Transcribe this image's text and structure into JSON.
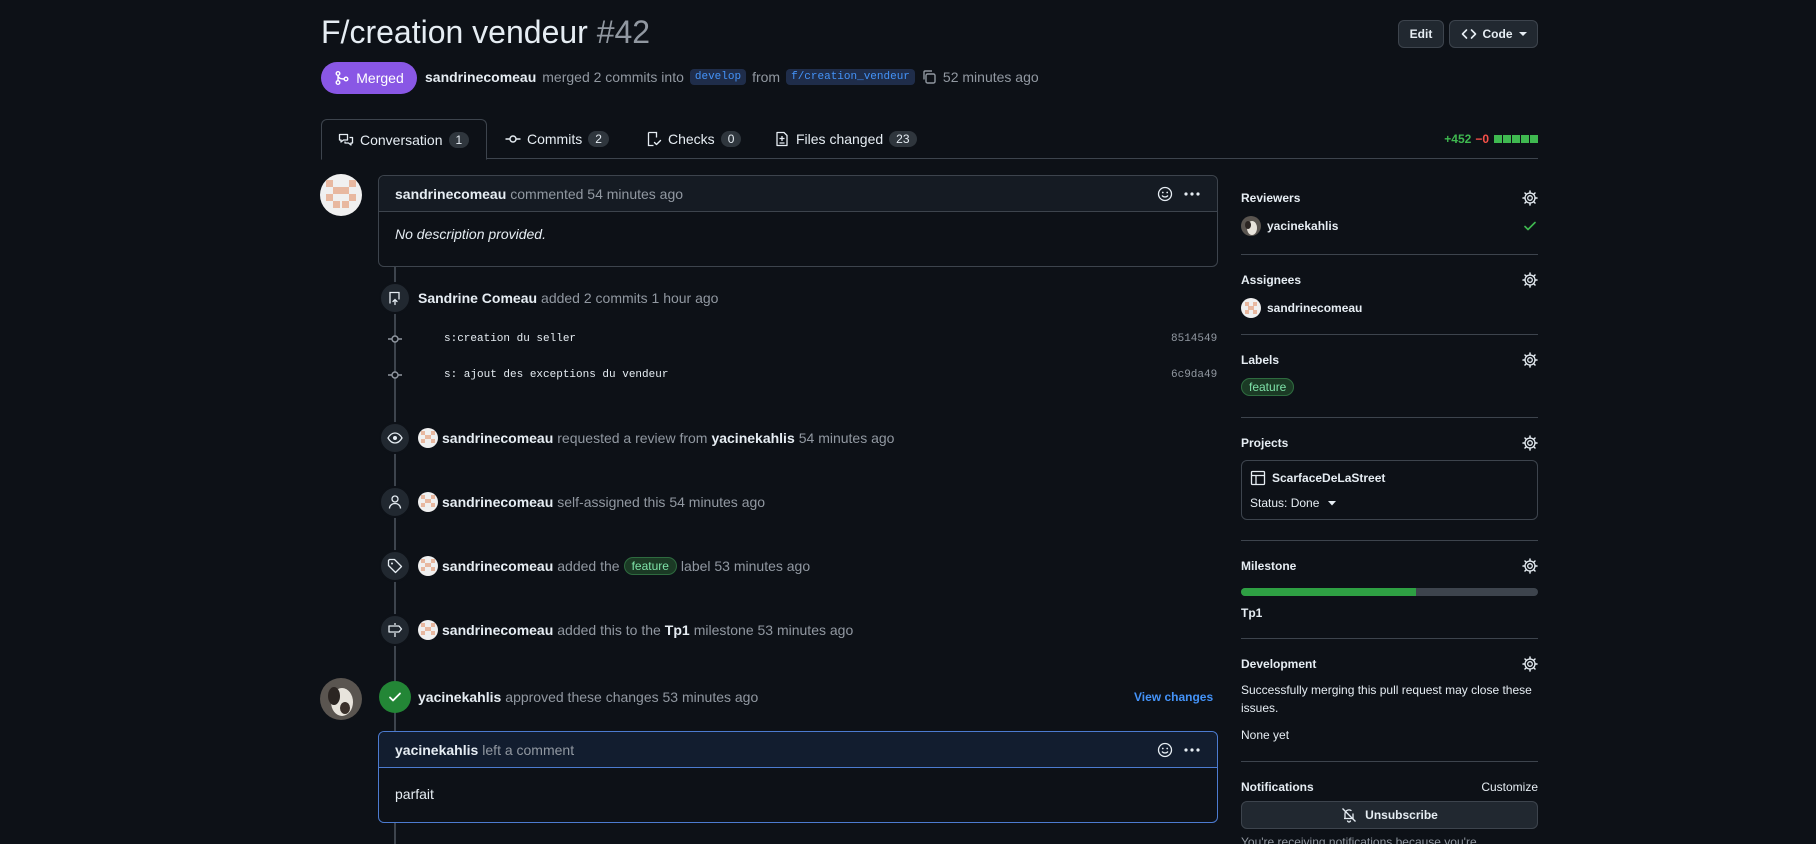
{
  "header": {
    "title": "F/creation vendeur",
    "number": "#42",
    "edit_label": "Edit",
    "code_label": "Code",
    "status": "Merged",
    "author": "sandrinecomeau",
    "merged_text": "merged 2 commits into",
    "base_branch": "develop",
    "from_text": "from",
    "head_branch": "f/creation_vendeur",
    "time": "52 minutes ago"
  },
  "tabs": [
    {
      "label": "Conversation",
      "count": "1"
    },
    {
      "label": "Commits",
      "count": "2"
    },
    {
      "label": "Checks",
      "count": "0"
    },
    {
      "label": "Files changed",
      "count": "23"
    }
  ],
  "diffstat": {
    "additions": "+452",
    "deletions": "−0",
    "bar_fraction": 1.0
  },
  "timeline": {
    "first_comment": {
      "author": "sandrinecomeau",
      "action": "commented 54 minutes ago",
      "body": "No description provided."
    },
    "commits_event": {
      "author": "Sandrine Comeau",
      "action": "added 2 commits 1 hour ago",
      "commits": [
        {
          "message": "s:creation du seller",
          "sha": "8514549"
        },
        {
          "message": "s: ajout des exceptions du vendeur",
          "sha": "6c9da49"
        }
      ]
    },
    "review_request": {
      "author": "sandrinecomeau",
      "action": "requested a review from",
      "reviewer": "yacinekahlis",
      "time": "54 minutes ago"
    },
    "self_assign": {
      "author": "sandrinecomeau",
      "action": "self-assigned this 54 minutes ago"
    },
    "label_event": {
      "author": "sandrinecomeau",
      "action": "added the",
      "label": "feature",
      "rest": "label 53 minutes ago"
    },
    "milestone_event": {
      "author": "sandrinecomeau",
      "action": "added this to the",
      "milestone": "Tp1",
      "rest": "milestone 53 minutes ago"
    },
    "approval": {
      "author": "yacinekahlis",
      "action": "approved these changes 53 minutes ago",
      "view_changes": "View changes"
    },
    "review_comment": {
      "author": "yacinekahlis",
      "action": "left a comment",
      "body": "parfait"
    }
  },
  "sidebar": {
    "reviewers": {
      "title": "Reviewers",
      "items": [
        "yacinekahlis"
      ]
    },
    "assignees": {
      "title": "Assignees",
      "items": [
        "sandrinecomeau"
      ]
    },
    "labels": {
      "title": "Labels",
      "items": [
        "feature"
      ]
    },
    "projects": {
      "title": "Projects",
      "project": "ScarfaceDeLaStreet",
      "status": "Status: Done"
    },
    "milestone": {
      "title": "Milestone",
      "name": "Tp1",
      "progress": 0.59
    },
    "development": {
      "title": "Development",
      "text": "Successfully merging this pull request may close these issues.",
      "none": "None yet"
    },
    "notifications": {
      "title": "Notifications",
      "customize": "Customize",
      "unsubscribe": "Unsubscribe",
      "footer": "You're receiving notifications because you're"
    }
  },
  "colors": {
    "merged": "#8957e5",
    "accent": "#4493f8",
    "success": "#3fb950",
    "background": "#0d1117"
  }
}
